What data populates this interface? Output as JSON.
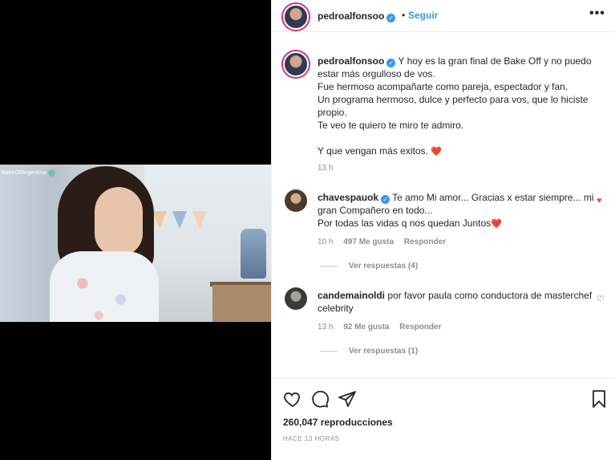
{
  "video": {
    "watermark": "BakeOffArgentina"
  },
  "header": {
    "username": "pedroalfonsoo",
    "separator": "•",
    "follow_label": "Seguir",
    "more_label": "•••"
  },
  "caption": {
    "username": "pedroalfonsoo",
    "lines": [
      "Y hoy es la gran final de Bake Off y no puedo estar más orgulloso de vos.",
      "Fue hermoso acompañarte como pareja, espectador y fan.",
      "Un programa hermoso, dulce y perfecto para vos, que lo hiciste propio.",
      "Te veo te quiero te miro te admiro.",
      "",
      "Y que vengan más exitos."
    ],
    "emoji": "❤️",
    "time": "13 h"
  },
  "comments": [
    {
      "username": "chavespauok",
      "text_line1": "Te amo Mi amor... Gracias x estar siempre... mi gran Compañero en todo...",
      "text_line2": "Por todas las vidas q nos quedan Juntos",
      "emoji": "❤️",
      "time": "10 h",
      "likes": "497 Me gusta",
      "reply": "Responder",
      "view_replies": "Ver respuestas (4)",
      "liked": true
    },
    {
      "username": "candemainoldi",
      "text_line1": "por favor paula como conductora de masterchef celebrity",
      "time": "13 h",
      "likes": "92 Me gusta",
      "reply": "Responder",
      "view_replies": "Ver respuestas (1)",
      "liked": false
    }
  ],
  "footer": {
    "views": "260,047 reproducciones",
    "ago": "HACE 13 HORAS"
  },
  "colors": {
    "accent": "#3897f0",
    "heart": "#ed4956",
    "muted": "#8e8e8e"
  }
}
